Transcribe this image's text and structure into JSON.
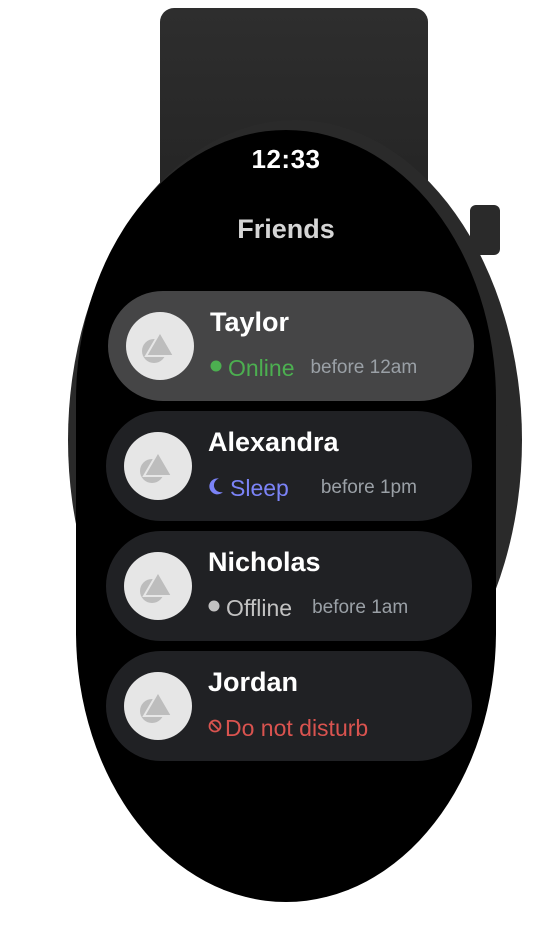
{
  "status_bar": {
    "time": "12:33"
  },
  "header": {
    "title": "Friends"
  },
  "colors": {
    "online": "#4caf50",
    "sleep": "#7b83f7",
    "offline": "#c2c2c2",
    "dnd": "#d9534f"
  },
  "friends": [
    {
      "name": "Taylor",
      "status": "Online",
      "status_icon": "online-dot-icon",
      "time": "before 12am"
    },
    {
      "name": "Alexandra",
      "status": "Sleep",
      "status_icon": "moon-icon",
      "time": "before 1pm"
    },
    {
      "name": "Nicholas",
      "status": "Offline",
      "status_icon": "offline-dot-icon",
      "time": "before 1am"
    },
    {
      "name": "Jordan",
      "status": "Do not disturb",
      "status_icon": "do-not-disturb-icon",
      "time": ""
    }
  ]
}
